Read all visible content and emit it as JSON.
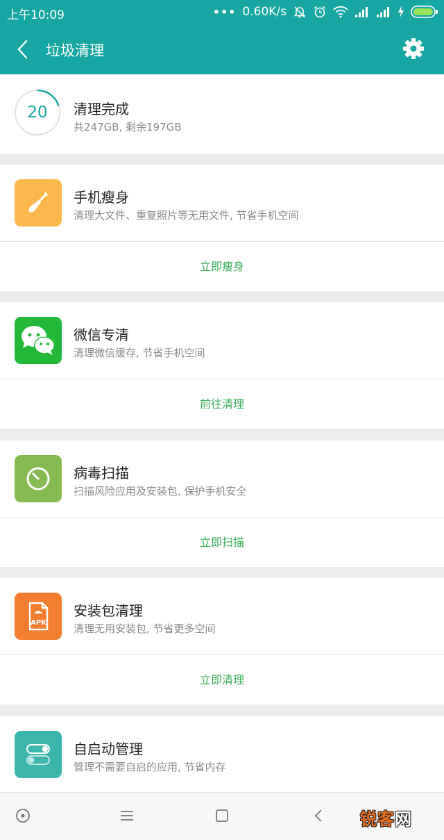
{
  "status": {
    "time": "上午10:09",
    "dots": "•••",
    "speed": "0.60K/s"
  },
  "header": {
    "title": "垃圾清理"
  },
  "summary": {
    "progress_value": "20",
    "progress_fraction": 0.2,
    "title": "清理完成",
    "subtitle": "共247GB, 剩余197GB"
  },
  "cards": [
    {
      "title": "手机瘦身",
      "subtitle": "清理大文件、重复照片等无用文件, 节省手机空间",
      "action": "立即瘦身",
      "icon": "shovel-icon",
      "color": "#fdb84b"
    },
    {
      "title": "微信专清",
      "subtitle": "清理微信缓存, 节省手机空间",
      "action": "前往清理",
      "icon": "wechat-icon",
      "color": "#22b838"
    },
    {
      "title": "病毒扫描",
      "subtitle": "扫描风险应用及安装包, 保护手机安全",
      "action": "立即扫描",
      "icon": "timer-icon",
      "color": "#85ba52"
    },
    {
      "title": "安装包清理",
      "subtitle": "清理无用安装包, 节省更多空间",
      "action": "立即清理",
      "icon": "apk-icon",
      "apk_label": "APK",
      "color": "#f47d30"
    },
    {
      "title": "自启动管理",
      "subtitle": "管理不需要自启的应用, 节省内存",
      "icon": "toggle-icon",
      "color": "#3ab6ad"
    }
  ],
  "watermark": {
    "text_a": "锐客",
    "text_b": "网"
  },
  "colors": {
    "accent": "#17a6a2",
    "action_green": "#3cae5a"
  }
}
